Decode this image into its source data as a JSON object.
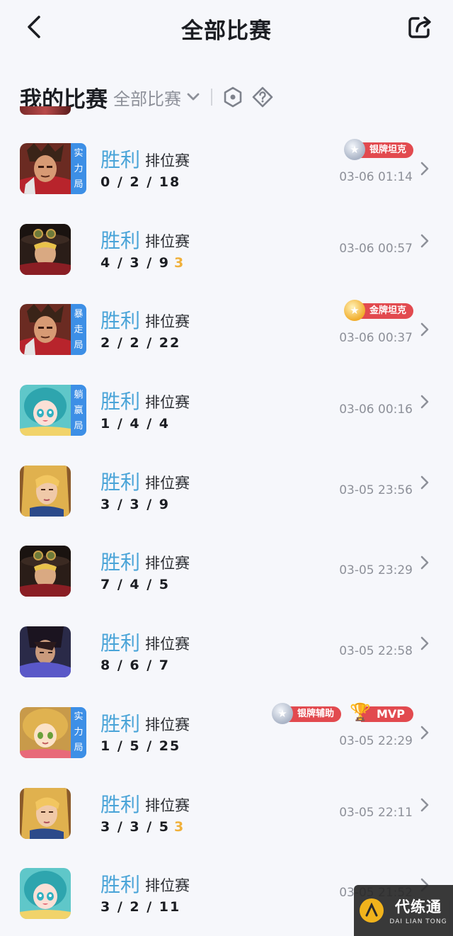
{
  "header": {
    "title": "全部比赛"
  },
  "subheader": {
    "section_title": "我的比赛",
    "filter_label": "全部比赛"
  },
  "matches": [
    {
      "result": "胜利",
      "mode": "排位赛",
      "kda": "0 / 2 / 18",
      "time": "03-06 01:14",
      "hero": "hero-red-warrior",
      "tag": [
        "实",
        "力",
        "局"
      ],
      "badges": [
        {
          "type": "silver",
          "label": "银牌坦克"
        }
      ]
    },
    {
      "result": "胜利",
      "mode": "排位赛",
      "kda": "4 / 3 / 9",
      "streak": "3",
      "time": "03-06 00:57",
      "hero": "hero-goggles-hat",
      "tag": [],
      "badges": []
    },
    {
      "result": "胜利",
      "mode": "排位赛",
      "kda": "2 / 2 / 22",
      "time": "03-06 00:37",
      "hero": "hero-red-warrior",
      "tag": [
        "暴",
        "走",
        "局"
      ],
      "badges": [
        {
          "type": "gold",
          "label": "金牌坦克"
        }
      ]
    },
    {
      "result": "胜利",
      "mode": "排位赛",
      "kda": "1 / 4 / 4",
      "time": "03-06 00:16",
      "hero": "hero-teal-girl",
      "tag": [
        "躺",
        "赢",
        "局"
      ],
      "badges": []
    },
    {
      "result": "胜利",
      "mode": "排位赛",
      "kda": "3 / 3 / 9",
      "time": "03-05 23:56",
      "hero": "hero-blonde",
      "tag": [],
      "badges": []
    },
    {
      "result": "胜利",
      "mode": "排位赛",
      "kda": "7 / 4 / 5",
      "time": "03-05 23:29",
      "hero": "hero-goggles-hat",
      "tag": [],
      "badges": []
    },
    {
      "result": "胜利",
      "mode": "排位赛",
      "kda": "8 / 6 / 7",
      "time": "03-05 22:58",
      "hero": "hero-dark-blue",
      "tag": [],
      "badges": []
    },
    {
      "result": "胜利",
      "mode": "排位赛",
      "kda": "1 / 5 / 25",
      "time": "03-05 22:29",
      "hero": "hero-golden-girl",
      "tag": [
        "实",
        "力",
        "局"
      ],
      "badges": [
        {
          "type": "silver",
          "label": "银牌辅助"
        },
        {
          "type": "mvp",
          "label": "MVP"
        }
      ]
    },
    {
      "result": "胜利",
      "mode": "排位赛",
      "kda": "3 / 3 / 5",
      "streak": "3",
      "time": "03-05 22:11",
      "hero": "hero-blonde",
      "tag": [],
      "badges": []
    },
    {
      "result": "胜利",
      "mode": "排位赛",
      "kda": "3 / 2 / 11",
      "time": "03-05 21:52",
      "hero": "hero-teal-girl",
      "tag": [],
      "badges": []
    }
  ],
  "watermark": {
    "main": "代练通",
    "sub": "DAI LIAN TONG"
  },
  "colors": {
    "background": "#f6f7fb",
    "result_blue": "#4aa4d8",
    "tag_blue": "#3d8fe6",
    "badge_red": "#e24a4f",
    "streak_gold": "#f0b03a"
  },
  "icons": {
    "back": "chevron-left-icon",
    "share": "share-icon",
    "filter": "chevron-down-icon",
    "hex": "hexagon-icon",
    "help": "diamond-question-icon",
    "row": "chevron-right-icon"
  }
}
